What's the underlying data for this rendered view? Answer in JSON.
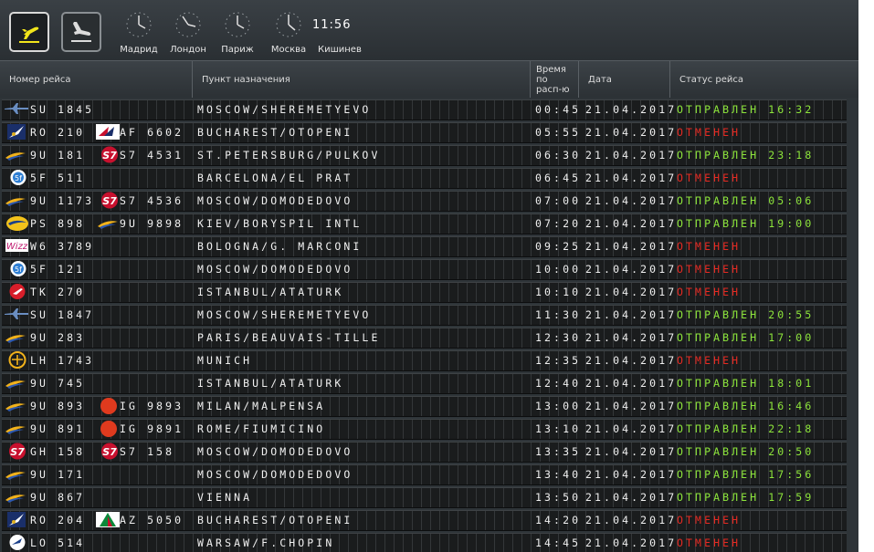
{
  "window": {
    "mode_departures_icon": "plane-departure-icon",
    "mode_arrivals_icon": "plane-arrival-icon"
  },
  "clocks": [
    {
      "city": "Мадрид"
    },
    {
      "city": "Лондон"
    },
    {
      "city": "Париж"
    },
    {
      "city": "Москва"
    }
  ],
  "current": {
    "time": "11:56",
    "city": "Кишинев"
  },
  "columns": {
    "flight": "Номер рейса",
    "destination": "Пункт назначения",
    "time_l1": "Время",
    "time_l2": "по",
    "time_l3": "расп-ю",
    "date": "Дата",
    "status": "Статус рейса"
  },
  "colors": {
    "board": "#2e3438",
    "ok": "#8ee63c",
    "cancel": "#e62a22",
    "text": "#f0f0f0",
    "accent_btn": "#f2e51b"
  },
  "flights": [
    {
      "logo": "aeroflot-logo",
      "flight": "SU 1845",
      "codeshare_logo": "",
      "codeshare": "",
      "dest": "MOSCOW/SHEREMETYEVO",
      "time": "00:45",
      "date": "21.04.2017",
      "status": "ОТПРАВЛЕН 16:32",
      "status_kind": "ok"
    },
    {
      "logo": "tarom-logo",
      "flight": "RO 210",
      "codeshare_logo": "airfrance-logo",
      "codeshare": "AF 6602",
      "dest": "BUCHAREST/OTOPENI",
      "time": "05:55",
      "date": "21.04.2017",
      "status": "ОТМЕНЕН",
      "status_kind": "cancel"
    },
    {
      "logo": "airmoldova-logo",
      "flight": "9U 181",
      "codeshare_logo": "s7-logo",
      "codeshare": "S7 4531",
      "dest": "ST.PETERSBURG/PULKOV",
      "time": "06:30",
      "date": "21.04.2017",
      "status": "ОТПРАВЛЕН 23:18",
      "status_kind": "ok"
    },
    {
      "logo": "fly-one-logo",
      "flight": "5F 511",
      "codeshare_logo": "",
      "codeshare": "",
      "dest": "BARCELONA/EL PRAT",
      "time": "06:45",
      "date": "21.04.2017",
      "status": "ОТМЕНЕН",
      "status_kind": "cancel"
    },
    {
      "logo": "airmoldova-logo",
      "flight": "9U 1173",
      "codeshare_logo": "s7-logo",
      "codeshare": "S7 4536",
      "dest": "MOSCOW/DOMODEDOVO",
      "time": "07:00",
      "date": "21.04.2017",
      "status": "ОТПРАВЛЕН 05:06",
      "status_kind": "ok"
    },
    {
      "logo": "uia-logo",
      "flight": "PS 898",
      "codeshare_logo": "airmoldova-logo",
      "codeshare": "9U 9898",
      "dest": "KIEV/BORYSPIL INTL",
      "time": "07:20",
      "date": "21.04.2017",
      "status": "ОТПРАВЛЕН 19:00",
      "status_kind": "ok"
    },
    {
      "logo": "wizzair-logo",
      "flight": "W6 3789",
      "codeshare_logo": "",
      "codeshare": "",
      "dest": "BOLOGNA/G. MARCONI",
      "time": "09:25",
      "date": "21.04.2017",
      "status": "ОТМЕНЕН",
      "status_kind": "cancel"
    },
    {
      "logo": "fly-one-logo",
      "flight": "5F 121",
      "codeshare_logo": "",
      "codeshare": "",
      "dest": "MOSCOW/DOMODEDOVO",
      "time": "10:00",
      "date": "21.04.2017",
      "status": "ОТМЕНЕН",
      "status_kind": "cancel"
    },
    {
      "logo": "turkish-logo",
      "flight": "TK 270",
      "codeshare_logo": "",
      "codeshare": "",
      "dest": "ISTANBUL/ATATURK",
      "time": "10:10",
      "date": "21.04.2017",
      "status": "ОТМЕНЕН",
      "status_kind": "cancel"
    },
    {
      "logo": "aeroflot-logo",
      "flight": "SU 1847",
      "codeshare_logo": "",
      "codeshare": "",
      "dest": "MOSCOW/SHEREMETYEVO",
      "time": "11:30",
      "date": "21.04.2017",
      "status": "ОТПРАВЛЕН 20:55",
      "status_kind": "ok"
    },
    {
      "logo": "airmoldova-logo",
      "flight": "9U 283",
      "codeshare_logo": "",
      "codeshare": "",
      "dest": "PARIS/BEAUVAIS-TILLE",
      "time": "12:30",
      "date": "21.04.2017",
      "status": "ОТПРАВЛЕН 17:00",
      "status_kind": "ok"
    },
    {
      "logo": "lufthansa-logo",
      "flight": "LH 1743",
      "codeshare_logo": "",
      "codeshare": "",
      "dest": "MUNICH",
      "time": "12:35",
      "date": "21.04.2017",
      "status": "ОТМЕНЕН",
      "status_kind": "cancel"
    },
    {
      "logo": "airmoldova-logo",
      "flight": "9U 745",
      "codeshare_logo": "",
      "codeshare": "",
      "dest": "ISTANBUL/ATATURK",
      "time": "12:40",
      "date": "21.04.2017",
      "status": "ОТПРАВЛЕН 18:01",
      "status_kind": "ok"
    },
    {
      "logo": "airmoldova-logo",
      "flight": "9U 893",
      "codeshare_logo": "icelandair-logo",
      "codeshare": "IG 9893",
      "dest": "MILAN/MALPENSA",
      "time": "13:00",
      "date": "21.04.2017",
      "status": "ОТПРАВЛЕН 16:46",
      "status_kind": "ok"
    },
    {
      "logo": "airmoldova-logo",
      "flight": "9U 891",
      "codeshare_logo": "icelandair-logo",
      "codeshare": "IG 9891",
      "dest": "ROME/FIUMICINO",
      "time": "13:10",
      "date": "21.04.2017",
      "status": "ОТПРАВЛЕН 22:18",
      "status_kind": "ok"
    },
    {
      "logo": "s7-logo",
      "flight": "GH 158",
      "codeshare_logo": "s7-logo",
      "codeshare": "S7 158",
      "dest": "MOSCOW/DOMODEDOVO",
      "time": "13:35",
      "date": "21.04.2017",
      "status": "ОТПРАВЛЕН 20:50",
      "status_kind": "ok"
    },
    {
      "logo": "airmoldova-logo",
      "flight": "9U 171",
      "codeshare_logo": "",
      "codeshare": "",
      "dest": "MOSCOW/DOMODEDOVO",
      "time": "13:40",
      "date": "21.04.2017",
      "status": "ОТПРАВЛЕН 17:56",
      "status_kind": "ok"
    },
    {
      "logo": "airmoldova-logo",
      "flight": "9U 867",
      "codeshare_logo": "",
      "codeshare": "",
      "dest": "VIENNA",
      "time": "13:50",
      "date": "21.04.2017",
      "status": "ОТПРАВЛЕН 17:59",
      "status_kind": "ok"
    },
    {
      "logo": "tarom-logo",
      "flight": "RO 204",
      "codeshare_logo": "alitalia-logo",
      "codeshare": "AZ 5050",
      "dest": "BUCHAREST/OTOPENI",
      "time": "14:20",
      "date": "21.04.2017",
      "status": "ОТМЕНЕН",
      "status_kind": "cancel"
    },
    {
      "logo": "lot-logo",
      "flight": "LO 514",
      "codeshare_logo": "",
      "codeshare": "",
      "dest": "WARSAW/F.CHOPIN",
      "time": "14:45",
      "date": "21.04.2017",
      "status": "ОТМЕНЕН",
      "status_kind": "cancel"
    }
  ]
}
